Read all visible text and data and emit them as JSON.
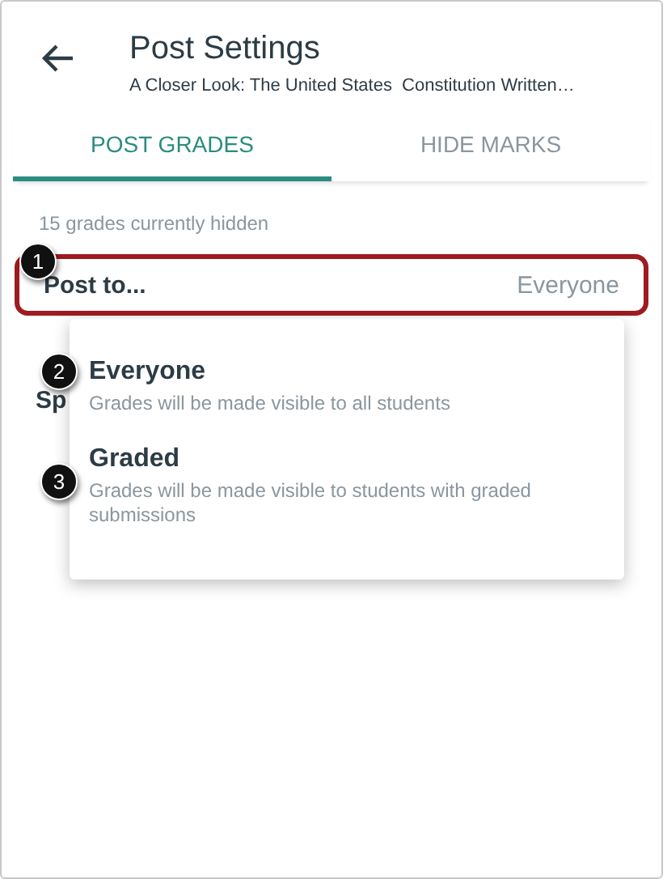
{
  "header": {
    "title": "Post Settings",
    "subtitle": "A Closer Look: The United States  Constitution Written…"
  },
  "tabs": [
    {
      "label": "POST GRADES",
      "selected": true
    },
    {
      "label": "HIDE MARKS",
      "selected": false
    }
  ],
  "hidden_count": "15 grades currently hidden",
  "post_to": {
    "label": "Post to...",
    "value": "Everyone"
  },
  "covered_label": "Sp",
  "menu": {
    "options": [
      {
        "title": "Everyone",
        "description": "Grades will be made visible to all students"
      },
      {
        "title": "Graded",
        "description": "Grades will be made visible to students with graded submissions"
      }
    ]
  },
  "callouts": [
    "1",
    "2",
    "3"
  ]
}
